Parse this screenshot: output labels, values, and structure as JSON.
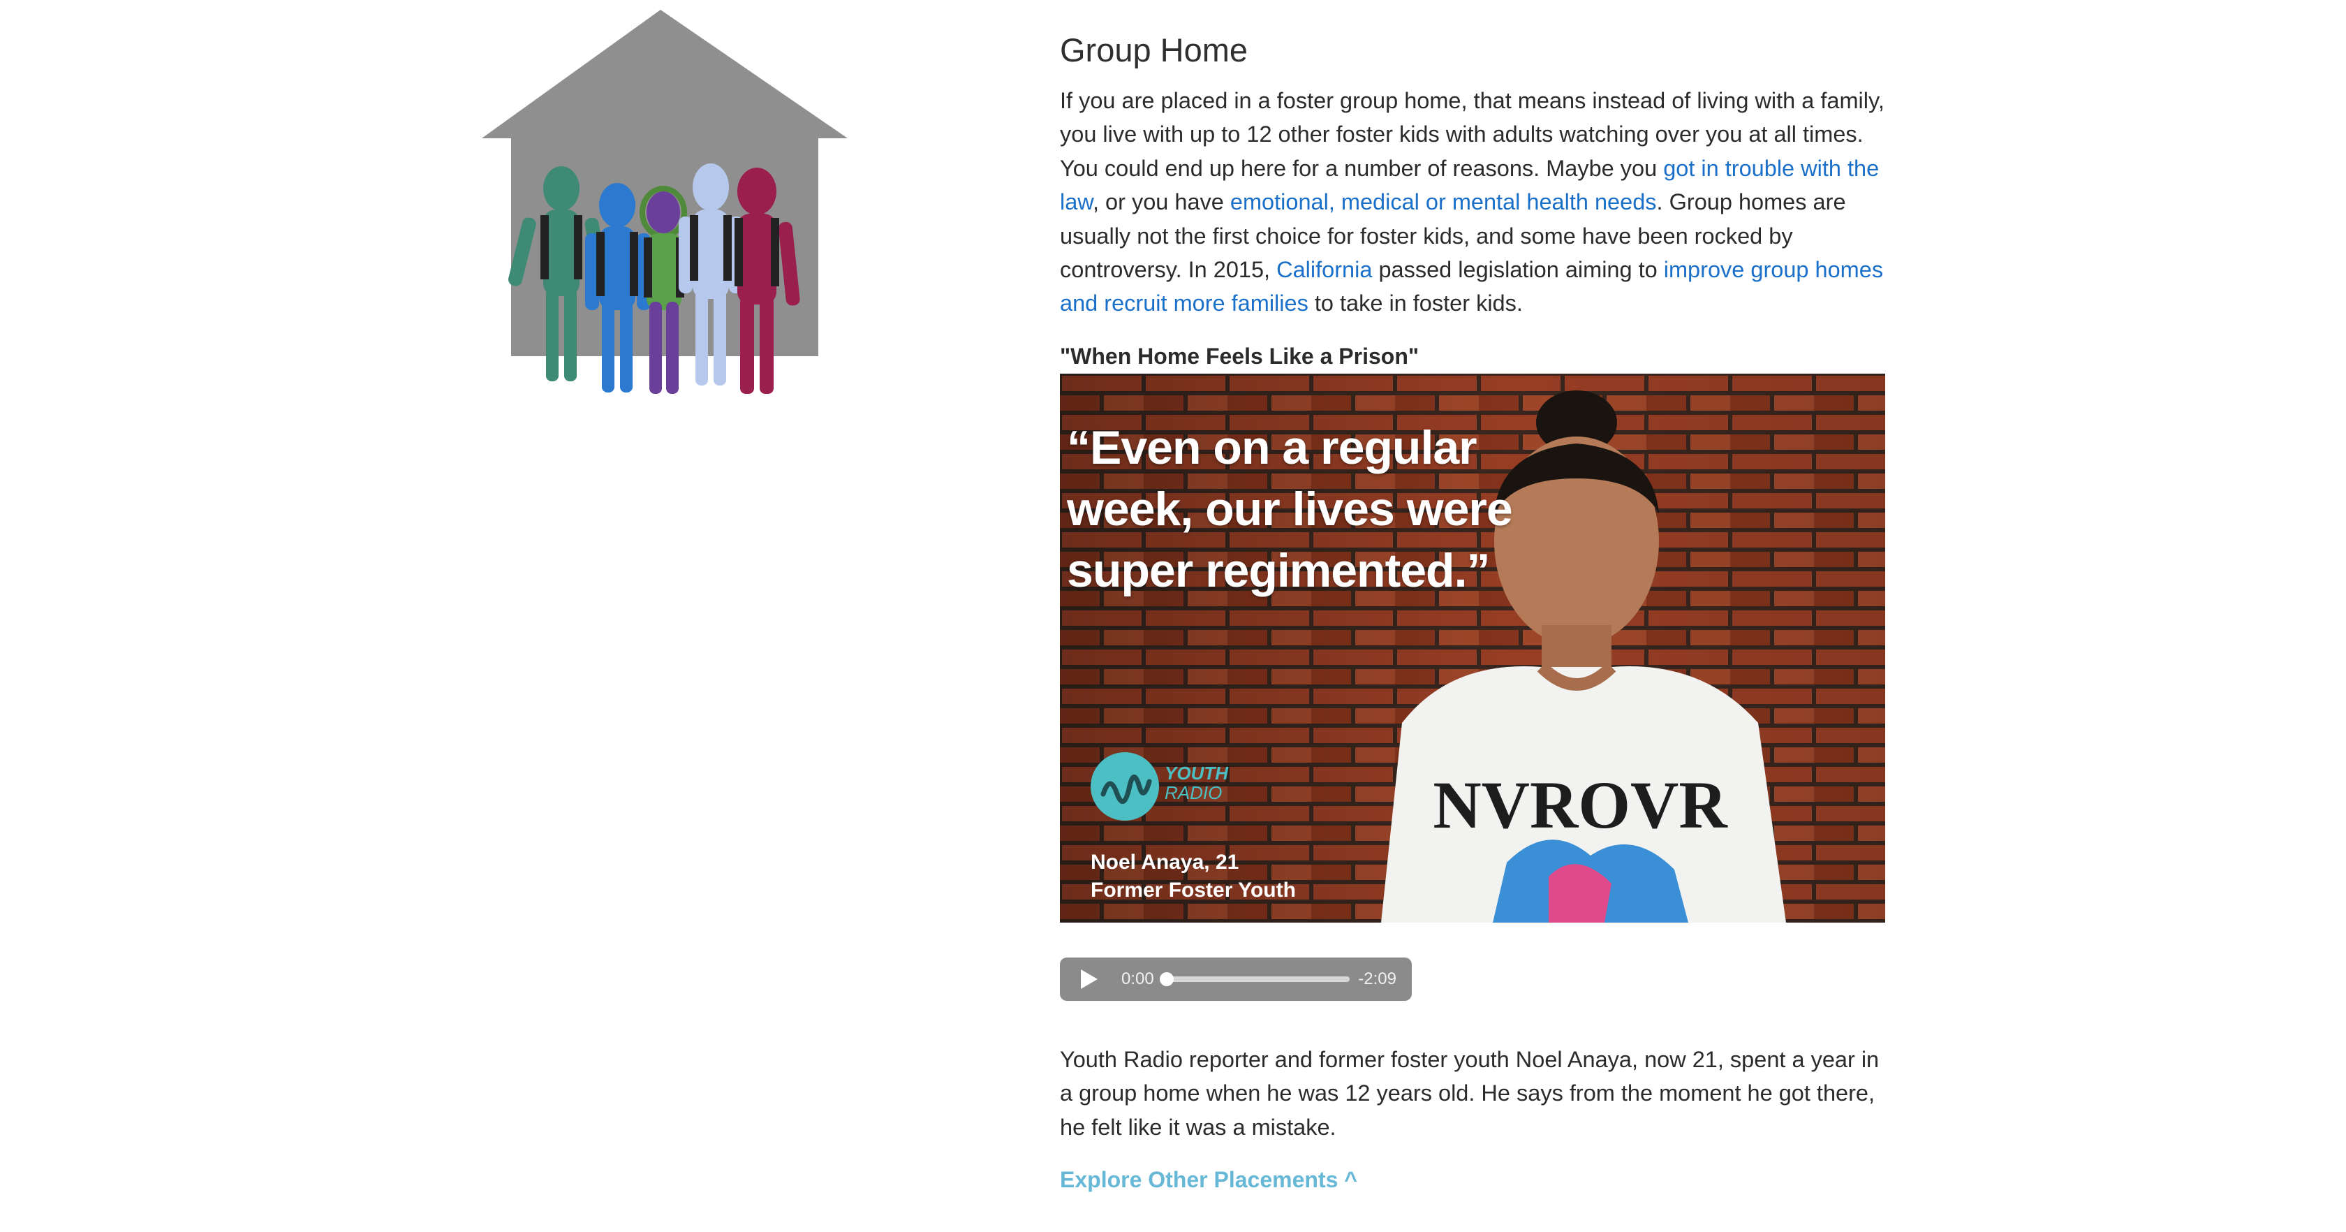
{
  "section": {
    "title": "Group Home"
  },
  "intro": {
    "part1": "If you are placed in a foster group home, that means instead of living with a family, you live with up to 12 other foster kids with adults watching over you at all times. You could end up here for a number of reasons. Maybe you ",
    "link1": "got in trouble with the law",
    "part2": ", or you have ",
    "link2": "emotional, medical or mental health needs",
    "part3": ". Group homes are usually not the first choice for foster kids, and some have been rocked by controversy. In 2015, ",
    "link3": "California",
    "part4": " passed legislation aiming to ",
    "link4": "improve group homes and recruit more families",
    "part5": " to take in foster kids."
  },
  "story": {
    "heading": "\"When Home Feels Like a Prison\"",
    "quote_line1": "“Even on a regular",
    "quote_line2": "week, our lives were",
    "quote_line3": "super regimented.”",
    "logo_line1": "YOUTH",
    "logo_line2": "RADIO",
    "credit_name": "Noel Anaya, 21",
    "credit_role": "Former Foster Youth",
    "shirt_text": "NVROVR"
  },
  "audio": {
    "current_time": "0:00",
    "remaining_time": "-2:09",
    "progress": 0
  },
  "after": {
    "text": "Youth Radio reporter and former foster youth Noel Anaya, now 21, spent a year in a group home when he was 12 years old. He says from the moment he got there, he felt like it was a mistake."
  },
  "nav": {
    "explore_label": "Explore Other Placements ^"
  },
  "colors": {
    "link": "#1a6fc9",
    "explore": "#67b8d7",
    "house": "#8f8f8f",
    "logo": "#4cbfc4"
  }
}
